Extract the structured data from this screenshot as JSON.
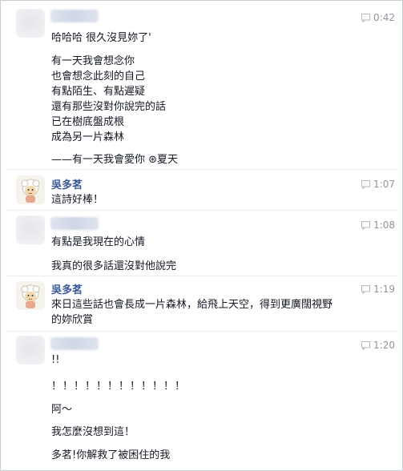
{
  "messages": [
    {
      "time": "0:42",
      "lines": [
        "哈哈哈 很久沒見妳了'",
        "有一天我會想念你",
        "也會想念此刻的自己",
        "有點陌生、有點遲疑",
        "還有那些沒對你說完的話",
        "已在樹底盤成根",
        "成為另一片森林",
        "——有一天我會愛你   ⊛夏天"
      ]
    },
    {
      "sender": "吳多茗",
      "time": "1:07",
      "lines": [
        "這詩好棒！"
      ]
    },
    {
      "time": "1:08",
      "lines": [
        "有點是我現在的心情",
        "我真的很多話還沒對他說完"
      ]
    },
    {
      "sender": "吳多茗",
      "time": "1:19",
      "lines": [
        "來日這些話也會長成一片森林，給飛上天空，得到更廣闊視野",
        "的妳欣賞"
      ]
    },
    {
      "time": "1:20",
      "lines": [
        "!!",
        "！！！！！！！！！！！！",
        "阿～",
        "我怎麼沒想到這！",
        "多茗!你解救了被困住的我"
      ]
    }
  ]
}
